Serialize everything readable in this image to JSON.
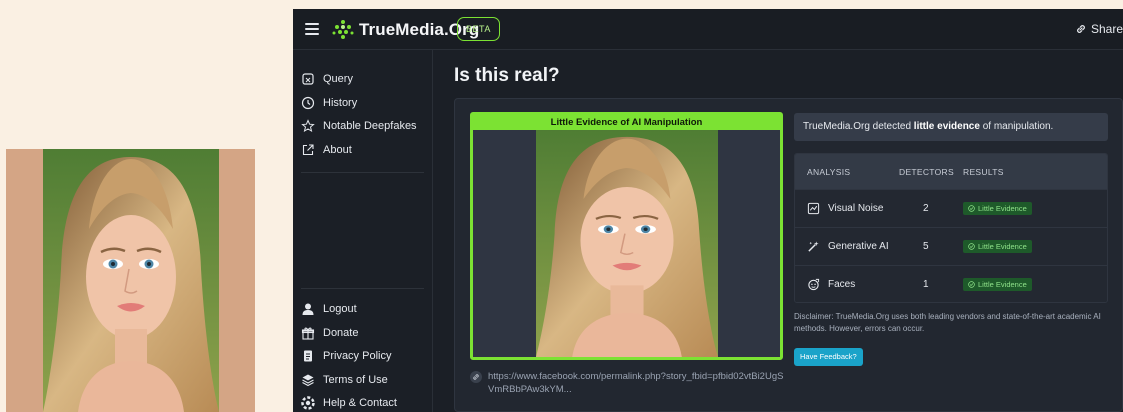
{
  "header": {
    "brand": "TrueMedia.Org",
    "beta_label": "BETA",
    "share_label": "Share"
  },
  "sidebar": {
    "top_items": [
      {
        "label": "Query",
        "icon": "query-icon"
      },
      {
        "label": "History",
        "icon": "clock-icon"
      },
      {
        "label": "Notable Deepfakes",
        "icon": "star-icon"
      },
      {
        "label": "About",
        "icon": "external-link-icon"
      }
    ],
    "bottom_items": [
      {
        "label": "Logout",
        "icon": "user-icon"
      },
      {
        "label": "Donate",
        "icon": "gift-icon"
      },
      {
        "label": "Privacy Policy",
        "icon": "document-icon"
      },
      {
        "label": "Terms of Use",
        "icon": "layers-icon"
      },
      {
        "label": "Help & Contact",
        "icon": "help-icon"
      }
    ]
  },
  "main": {
    "title": "Is this real?",
    "verdict_banner": "Little Evidence of AI Manipulation",
    "summary": {
      "prefix": "TrueMedia.Org detected ",
      "emphasis": "little evidence",
      "suffix": " of manipulation."
    },
    "table": {
      "headers": [
        "ANALYSIS",
        "DETECTORS",
        "RESULTS"
      ],
      "rows": [
        {
          "analysis": "Visual Noise",
          "detectors": "2",
          "result": "Little Evidence",
          "icon": "noise-chart-icon"
        },
        {
          "analysis": "Generative AI",
          "detectors": "5",
          "result": "Little Evidence",
          "icon": "magic-wand-icon"
        },
        {
          "analysis": "Faces",
          "detectors": "1",
          "result": "Little Evidence",
          "icon": "face-icon"
        }
      ]
    },
    "disclaimer": "Disclaimer: TrueMedia.Org uses both leading vendors and state-of-the-art academic AI methods. However, errors can occur.",
    "feedback_label": "Have Feedback?",
    "source_url": "https://www.facebook.com/permalink.php?story_fbid=pfbid02vtBi2UgSVmRBbPAw3kYM..."
  },
  "colors": {
    "accent_green": "#7ce233",
    "feedback_blue": "#1aa3c9",
    "badge_bg": "#1e5a2a",
    "badge_text": "#8fe28a",
    "app_bg": "#1b1f26",
    "page_bg": "#faf0e3",
    "photo_panel_bg": "#d4a585"
  }
}
